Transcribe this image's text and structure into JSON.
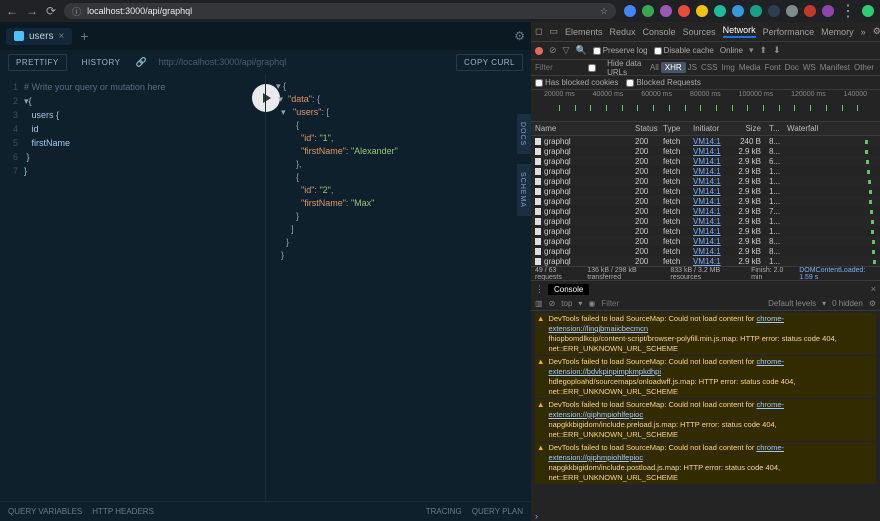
{
  "browser": {
    "url": "localhost:3000/api/graphql"
  },
  "playground": {
    "tab_label": "users",
    "buttons": {
      "prettify": "PRETTIFY",
      "history": "HISTORY",
      "copy": "COPY CURL"
    },
    "endpoint_url": "http://localhost:3000/api/graphql",
    "query_comment": "# Write your query or mutation here",
    "query_lines": [
      "{",
      "  users {",
      "    id",
      "    firstName",
      "  }",
      "}"
    ],
    "sidetabs": {
      "docs": "DOCS",
      "schema": "SCHEMA"
    },
    "footer": {
      "qv": "QUERY VARIABLES",
      "hh": "HTTP HEADERS",
      "tracing": "TRACING",
      "qp": "QUERY PLAN"
    },
    "response": {
      "data_key": "\"data\"",
      "users_key": "\"users\"",
      "rows": [
        {
          "id": "\"1\"",
          "firstName": "\"Alexander\""
        },
        {
          "id": "\"2\"",
          "firstName": "\"Max\""
        }
      ],
      "id_key": "\"id\"",
      "fn_key": "\"firstName\""
    }
  },
  "devtools": {
    "tabs": [
      "Elements",
      "Redux",
      "Console",
      "Sources",
      "Network",
      "Performance",
      "Memory"
    ],
    "active_tab": "Network",
    "toolbar": {
      "preserve": "Preserve log",
      "disable": "Disable cache",
      "online": "Online"
    },
    "filter": {
      "placeholder": "Filter",
      "hide": "Hide data URLs",
      "types": [
        "All",
        "XHR",
        "JS",
        "CSS",
        "Img",
        "Media",
        "Font",
        "Doc",
        "WS",
        "Manifest",
        "Other"
      ],
      "active": "XHR",
      "blocked_cookies": "Has blocked cookies",
      "blocked_req": "Blocked Requests"
    },
    "timeline": {
      "ticks": [
        "20000 ms",
        "40000 ms",
        "60000 ms",
        "80000 ms",
        "100000 ms",
        "120000 ms",
        "140000"
      ]
    },
    "net_headers": [
      "Name",
      "Status",
      "Type",
      "Initiator",
      "Size",
      "T...",
      "Waterfall"
    ],
    "net_rows": [
      {
        "name": "graphql",
        "status": "200",
        "type": "fetch",
        "init": "VM14:1",
        "size": "240 B",
        "time": "8...",
        "wf": 88
      },
      {
        "name": "graphql",
        "status": "200",
        "type": "fetch",
        "init": "VM14:1",
        "size": "2.9 kB",
        "time": "8...",
        "wf": 88
      },
      {
        "name": "graphql",
        "status": "200",
        "type": "fetch",
        "init": "VM14:1",
        "size": "2.9 kB",
        "time": "6...",
        "wf": 89
      },
      {
        "name": "graphql",
        "status": "200",
        "type": "fetch",
        "init": "VM14:1",
        "size": "2.9 kB",
        "time": "1...",
        "wf": 90
      },
      {
        "name": "graphql",
        "status": "200",
        "type": "fetch",
        "init": "VM14:1",
        "size": "2.9 kB",
        "time": "1...",
        "wf": 91
      },
      {
        "name": "graphql",
        "status": "200",
        "type": "fetch",
        "init": "VM14:1",
        "size": "2.9 kB",
        "time": "1...",
        "wf": 92
      },
      {
        "name": "graphql",
        "status": "200",
        "type": "fetch",
        "init": "VM14:1",
        "size": "2.9 kB",
        "time": "1...",
        "wf": 92
      },
      {
        "name": "graphql",
        "status": "200",
        "type": "fetch",
        "init": "VM14:1",
        "size": "2.9 kB",
        "time": "7...",
        "wf": 93
      },
      {
        "name": "graphql",
        "status": "200",
        "type": "fetch",
        "init": "VM14:1",
        "size": "2.9 kB",
        "time": "1...",
        "wf": 94
      },
      {
        "name": "graphql",
        "status": "200",
        "type": "fetch",
        "init": "VM14:1",
        "size": "2.9 kB",
        "time": "1...",
        "wf": 94
      },
      {
        "name": "graphql",
        "status": "200",
        "type": "fetch",
        "init": "VM14:1",
        "size": "2.9 kB",
        "time": "8...",
        "wf": 95
      },
      {
        "name": "graphql",
        "status": "200",
        "type": "fetch",
        "init": "VM14:1",
        "size": "2.9 kB",
        "time": "8...",
        "wf": 96
      },
      {
        "name": "graphql",
        "status": "200",
        "type": "fetch",
        "init": "VM14:1",
        "size": "2.9 kB",
        "time": "1...",
        "wf": 97
      }
    ],
    "net_footer": {
      "requests": "49 / 63 requests",
      "transferred": "136 kB / 298 kB transferred",
      "resources": "833 kB / 3.2 MB resources",
      "finish": "Finish: 2.0 min",
      "dom": "DOMContentLoaded: 1.59 s"
    },
    "console": {
      "tab": "Console",
      "context": "top",
      "filter_ph": "Filter",
      "levels": "Default levels",
      "hidden": "0 hidden",
      "warns": [
        {
          "msg": "DevTools failed to load SourceMap: Could not load content for ",
          "url": "chrome-extension://lingjbmaiicbecmcn",
          "line2": "fhiopbomdlkcip/content-script/browser-polyfill.min.js.map",
          "tail": ": HTTP error: status code 404, net::ERR_UNKNOWN_URL_SCHEME"
        },
        {
          "msg": "DevTools failed to load SourceMap: Could not load content for ",
          "url": "chrome-extension://bdvkpinpimpkmpkdhpi",
          "line2": "hdlegoploahd/sourcemaps/onloadwff.js.map",
          "tail": ": HTTP error: status code 404, net::ERR_UNKNOWN_URL_SCHEME"
        },
        {
          "msg": "DevTools failed to load SourceMap: Could not load content for ",
          "url": "chrome-extension://giphmpiohlfepioc",
          "line2": "napgkkbigidom/include.preload.js.map",
          "tail": ": HTTP error: status code 404, net::ERR_UNKNOWN_URL_SCHEME"
        },
        {
          "msg": "DevTools failed to load SourceMap: Could not load content for ",
          "url": "chrome-extension://giphmpiohlfepioc",
          "line2": "napgkkbigidom/include.postload.js.map",
          "tail": ": HTTP error: status code 404, net::ERR_UNKNOWN_URL_SCHEME"
        }
      ]
    }
  }
}
